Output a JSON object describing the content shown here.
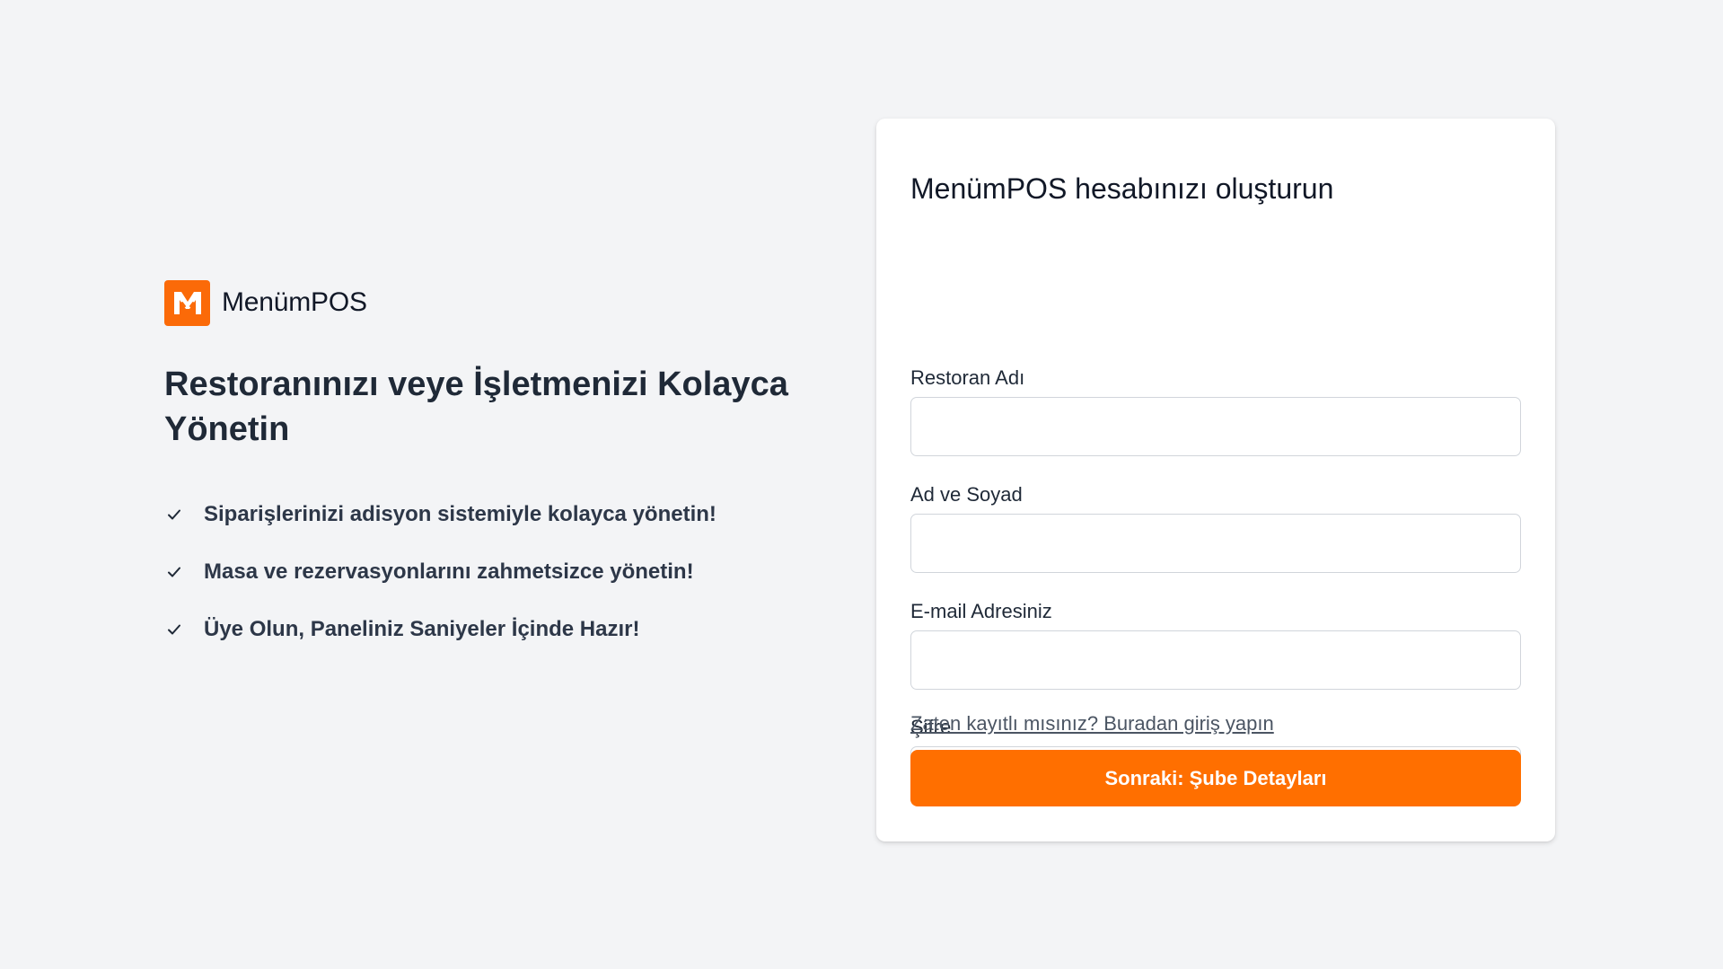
{
  "brand": {
    "name": "MenümPOS",
    "logo_icon": "fork-knife-m-logo-icon",
    "accent_color": "#fb6a08"
  },
  "hero": {
    "title": "Restoranınızı veye İşletmenizi Kolayca Yönetin",
    "features": [
      {
        "icon": "check-icon",
        "text": "Siparişlerinizi adisyon sistemiyle kolayca yönetin!"
      },
      {
        "icon": "check-icon",
        "text": "Masa ve rezervasyonlarını zahmetsizce yönetin!"
      },
      {
        "icon": "check-icon",
        "text": "Üye Olun, Paneliniz Saniyeler İçinde Hazır!"
      }
    ]
  },
  "form": {
    "title": "MenümPOS hesabınızı oluşturun",
    "fields": [
      {
        "label": "Restoran Adı",
        "value": "",
        "placeholder": ""
      },
      {
        "label": "Ad ve Soyad",
        "value": "",
        "placeholder": ""
      },
      {
        "label": "E-mail Adresiniz",
        "value": "",
        "placeholder": ""
      },
      {
        "label": "Şifre",
        "value": "",
        "placeholder": ""
      }
    ],
    "login_link": "Zaten kayıtlı mısınız? Buradan giriş yapın",
    "submit_label": "Sonraki: Şube Detayları",
    "submit_color": "#ff6f00"
  }
}
